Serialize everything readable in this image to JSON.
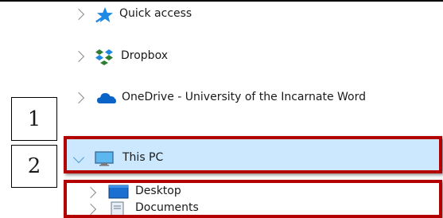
{
  "nav": {
    "items": [
      {
        "label": "Quick access",
        "icon": "star-icon"
      },
      {
        "label": "Dropbox",
        "icon": "dropbox-icon"
      },
      {
        "label": "OneDrive - University of the Incarnate Word",
        "icon": "onedrive-cloud-icon"
      },
      {
        "label": "This PC",
        "icon": "monitor-icon",
        "expanded": true,
        "selected": true
      },
      {
        "label": "Desktop",
        "icon": "desktop-folder-icon"
      },
      {
        "label": "Documents",
        "icon": "documents-folder-icon"
      }
    ]
  },
  "annotations": {
    "one": "1",
    "two": "2"
  },
  "colors": {
    "selection": "#cce8ff",
    "highlight_border": "#b30000",
    "star": "#1e88e5",
    "onedrive": "#0a64c8"
  }
}
